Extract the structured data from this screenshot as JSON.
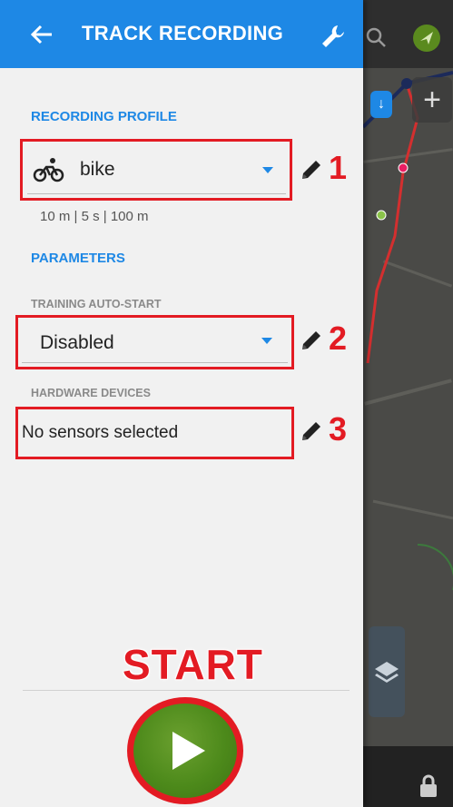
{
  "header": {
    "title": "TRACK RECORDING"
  },
  "recording_profile": {
    "section_title": "RECORDING PROFILE",
    "selected": "bike",
    "params": "10 m | 5 s | 100 m",
    "marker": "1"
  },
  "parameters": {
    "section_title": "PARAMETERS",
    "training": {
      "label": "TRAINING AUTO-START",
      "value": "Disabled",
      "marker": "2"
    },
    "hardware": {
      "label": "HARDWARE DEVICES",
      "value": "No sensors selected",
      "marker": "3"
    }
  },
  "start": {
    "label": "START"
  },
  "colors": {
    "accent": "#1e88e5",
    "annotation": "#e31b23",
    "start_green": "#4d8a1b"
  },
  "icons": [
    "back-arrow-icon",
    "wrench-icon",
    "bike-icon",
    "dropdown-arrow-icon",
    "pencil-icon",
    "play-icon",
    "layers-icon",
    "search-icon",
    "plus-icon",
    "lock-icon",
    "gps-icon"
  ]
}
